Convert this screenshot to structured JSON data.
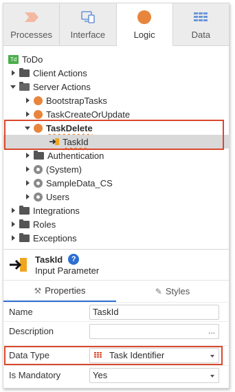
{
  "tabs": [
    {
      "label": "Processes",
      "icon": "processes-chevron-icon"
    },
    {
      "label": "Interface",
      "icon": "screen-icon"
    },
    {
      "label": "Logic",
      "icon": "logic-circle-icon",
      "active": true
    },
    {
      "label": "Data",
      "icon": "data-grid-icon"
    }
  ],
  "tree": {
    "app_badge": "Td",
    "app_name": "ToDo",
    "client_actions": "Client Actions",
    "server_actions": "Server Actions",
    "bootstrap_tasks": "BootstrapTasks",
    "task_create_or_update": "TaskCreateOrUpdate",
    "task_delete": "TaskDelete",
    "task_id": "TaskId",
    "authentication": "Authentication",
    "system": "(System)",
    "sample_data": "SampleData_CS",
    "users": "Users",
    "integrations": "Integrations",
    "roles": "Roles",
    "exceptions": "Exceptions"
  },
  "details": {
    "name": "TaskId",
    "help": "?",
    "kind": "Input Parameter",
    "properties_tab": "Properties",
    "styles_tab": "Styles"
  },
  "properties": {
    "name_label": "Name",
    "name_value": "TaskId",
    "description_label": "Description",
    "description_value": "",
    "description_more": "...",
    "data_type_label": "Data Type",
    "data_type_value": "Task Identifier",
    "mandatory_label": "Is Mandatory",
    "mandatory_value": "Yes"
  },
  "colors": {
    "accent": "#2c6fd1",
    "orange": "#e8853d",
    "highlight": "#d9472b"
  }
}
